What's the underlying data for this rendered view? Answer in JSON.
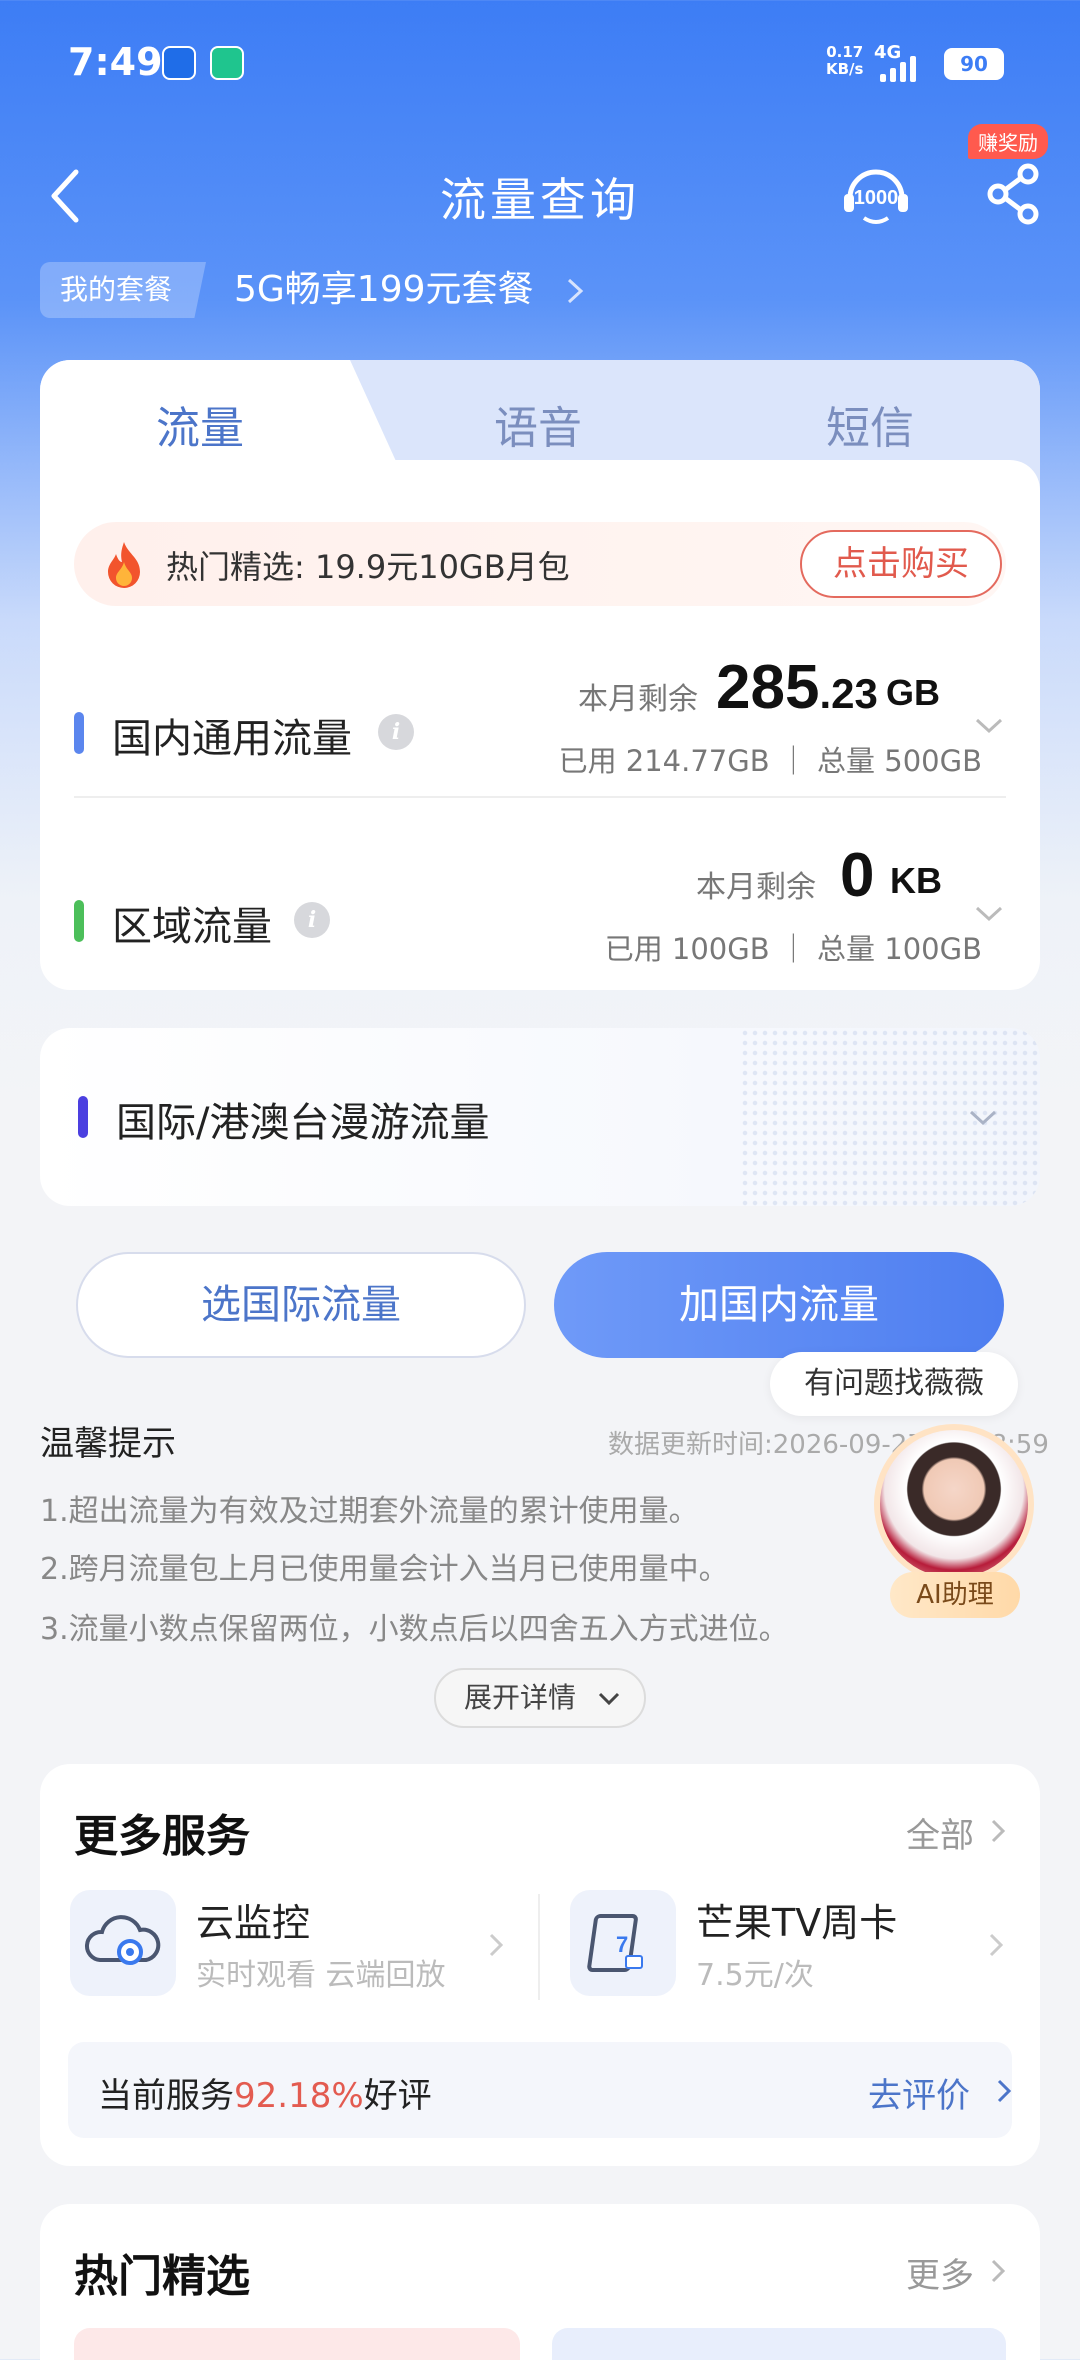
{
  "status_bar": {
    "time": "7:49",
    "net_speed_value": "0.17",
    "net_speed_unit": "KB/s",
    "network": "4G",
    "battery": "90"
  },
  "header": {
    "title": "流量查询",
    "reward_badge": "赚奖励",
    "back_icon": "chevron-left-icon",
    "hotline_icon": "10000-hotline-icon",
    "share_icon": "share-icon"
  },
  "plan": {
    "tag": "我的套餐",
    "name": "5G畅享199元套餐"
  },
  "tabs": [
    {
      "label": "流量",
      "active": true
    },
    {
      "label": "语音",
      "active": false
    },
    {
      "label": "短信",
      "active": false
    }
  ],
  "promo": {
    "text": "热门精选: 19.9元10GB月包",
    "button": "点击购买"
  },
  "usage": {
    "remain_label": "本月剩余",
    "domestic": {
      "title": "国内通用流量",
      "remain_int": "285",
      "remain_dec": ".23",
      "remain_unit": "GB",
      "detail": "已用 214.77GB ｜ 总量 500GB"
    },
    "regional": {
      "title": "区域流量",
      "remain_int": "0",
      "remain_unit": "KB",
      "detail": "已用 100GB ｜ 总量 100GB"
    }
  },
  "roaming": {
    "title": "国际/港澳台漫游流量"
  },
  "actions": {
    "intl": "选国际流量",
    "domestic": "加国内流量"
  },
  "assistant": {
    "bubble": "有问题找薇薇",
    "label": "AI助理"
  },
  "tips": {
    "title": "温馨提示",
    "update_time": "数据更新时间:2026-09-27 07:48:59",
    "lines": [
      "1.超出流量为有效及过期套外流量的累计使用量。",
      "2.跨月流量包上月已使用量会计入当月已使用量中。",
      "3.流量小数点保留两位，小数点后以四舍五入方式进位。"
    ],
    "expand": "展开详情"
  },
  "services": {
    "title": "更多服务",
    "all": "全部",
    "items": [
      {
        "name": "云监控",
        "desc": "实时观看 云端回放",
        "icon": "cloud-camera-icon"
      },
      {
        "name": "芒果TV周卡",
        "desc": "7.5元/次",
        "icon": "tv-card-icon"
      }
    ],
    "rating_prefix": "当前服务",
    "rating_pct": "92.18%",
    "rating_suffix": "好评",
    "rate_link": "去评价"
  },
  "hot": {
    "title": "热门精选",
    "more": "更多"
  },
  "colors": {
    "brand_blue": "#3d7df5",
    "accent_red": "#e35b50",
    "domestic_bar": "#5b86ee",
    "regional_bar": "#4cbf5a",
    "roaming_bar": "#4b3fe0"
  }
}
